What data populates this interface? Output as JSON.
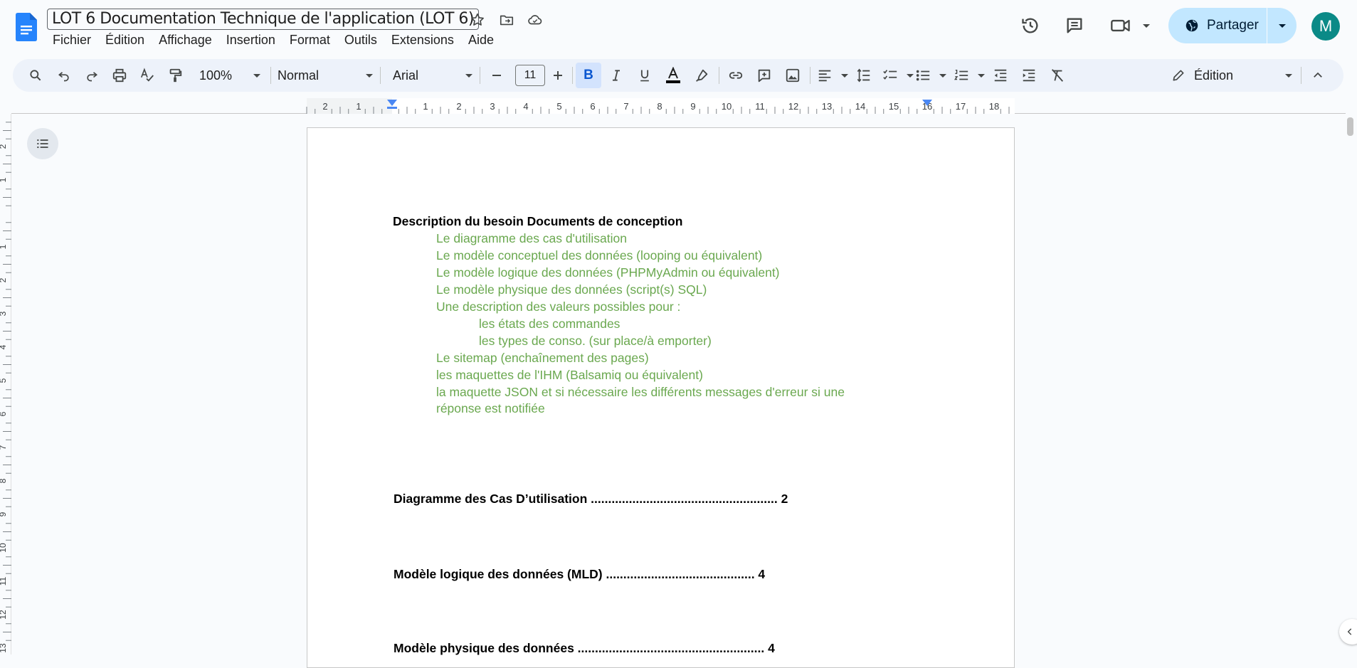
{
  "header": {
    "doc_title": "LOT 6 Documentation Technique de l'application (LOT 6)",
    "menu": [
      "Fichier",
      "Édition",
      "Affichage",
      "Insertion",
      "Format",
      "Outils",
      "Extensions",
      "Aide"
    ],
    "share_label": "Partager",
    "avatar_initial": "M"
  },
  "toolbar": {
    "zoom": "100%",
    "style": "Normal",
    "font": "Arial",
    "font_size": "11",
    "bold_label": "B",
    "mode": "Édition"
  },
  "ruler": {
    "left_labels": [
      "2",
      "1"
    ],
    "labels": [
      "1",
      "2",
      "3",
      "4",
      "5",
      "6",
      "7",
      "8",
      "9",
      "10",
      "11",
      "12",
      "13",
      "14",
      "15",
      "16",
      "17",
      "18"
    ]
  },
  "document": {
    "heading": "Description du besoin Documents de conception",
    "items": [
      "Le diagramme des cas d'utilisation",
      "Le modèle conceptuel des données (looping ou équivalent)",
      "Le modèle logique des données (PHPMyAdmin ou équivalent)",
      "Le modèle physique des données (script(s) SQL)",
      "Une description des valeurs possibles pour :"
    ],
    "subitems": [
      "les états des commandes",
      "les types de conso. (sur place/à emporter)"
    ],
    "items2": [
      "Le sitemap (enchaînement des pages)",
      "les maquettes de l'IHM (Balsamiq ou équivalent)",
      "la maquette JSON et si nécessaire les différents messages d'erreur si une",
      "réponse est notifiée"
    ],
    "toc": [
      "Diagramme des Cas D’utilisation ...................................................... 2",
      "Modèle logique des données (MLD) ........................................... 4",
      "Modèle physique des données ...................................................... 4"
    ]
  },
  "colors": {
    "accent": "#0b57d0",
    "green_text": "#6aa84f",
    "share_bg": "#c2e7ff",
    "avatar_bg": "#0b8a87"
  }
}
